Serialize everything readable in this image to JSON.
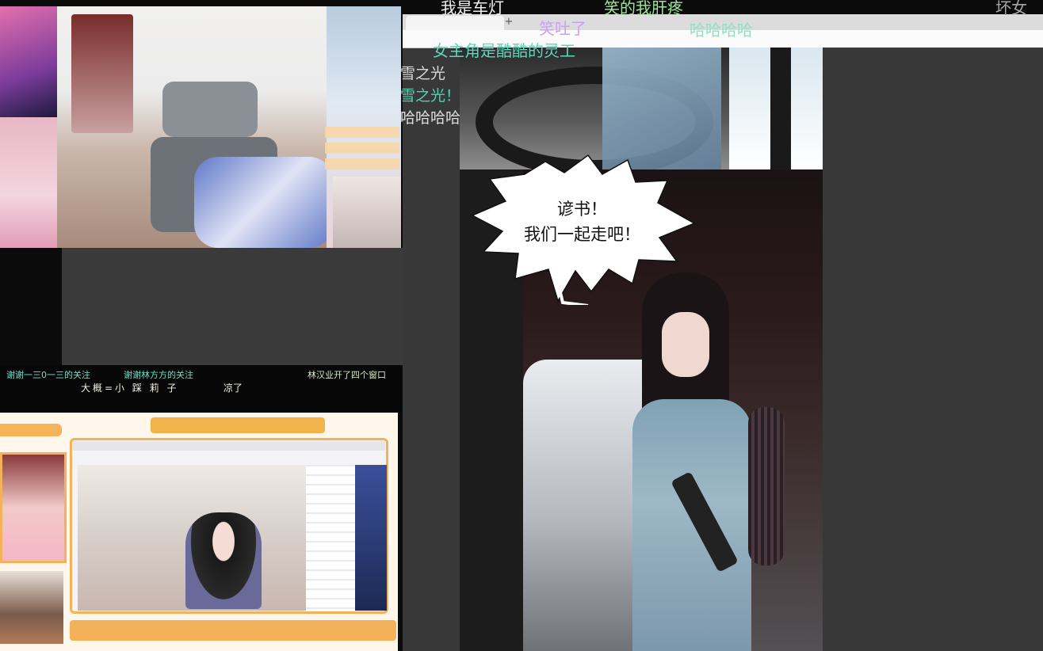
{
  "danmaku": {
    "top": [
      {
        "text": "我是车灯",
        "color": "#f0f0f0"
      },
      {
        "text": "笑的我肝疼",
        "color": "#9fe49b"
      },
      {
        "text": "坏女",
        "color": "#a7a7a7"
      },
      {
        "text": "笑吐了",
        "color": "#c8a0f5"
      },
      {
        "text": "哈哈哈哈",
        "color": "#8fe0c2"
      },
      {
        "text": "女主角是酷酷的灵工",
        "color": "#5fd6b7"
      }
    ],
    "left": [
      {
        "text": "雪之光",
        "color": "#d9d9d9"
      },
      {
        "text": "雪之光！",
        "color": "#4fd4b0"
      },
      {
        "text": "哈哈哈哈",
        "color": "#dcdcdc"
      }
    ]
  },
  "stream_top": {
    "gift_rows": [
      "",
      "",
      "",
      ""
    ]
  },
  "caption_strip": {
    "line1_a": "谢谢一三0一三的关注",
    "line1_b": "谢谢林方方的关注",
    "line1_c": "林汉业开了四个窗口",
    "line2_a": "大概=小 踩 莉 子",
    "line2_b": "凉了"
  },
  "stream_bot": {
    "header": "",
    "tag": "",
    "footer": ""
  },
  "browser": {
    "tab_title": "",
    "new_tab": "+"
  },
  "bubble": {
    "line1": "谚书！",
    "line2": "我们一起走吧！"
  },
  "colors": {
    "background": "#0b0b0b",
    "browser_bg": "#383838",
    "accent_orange": "#f3b259"
  }
}
